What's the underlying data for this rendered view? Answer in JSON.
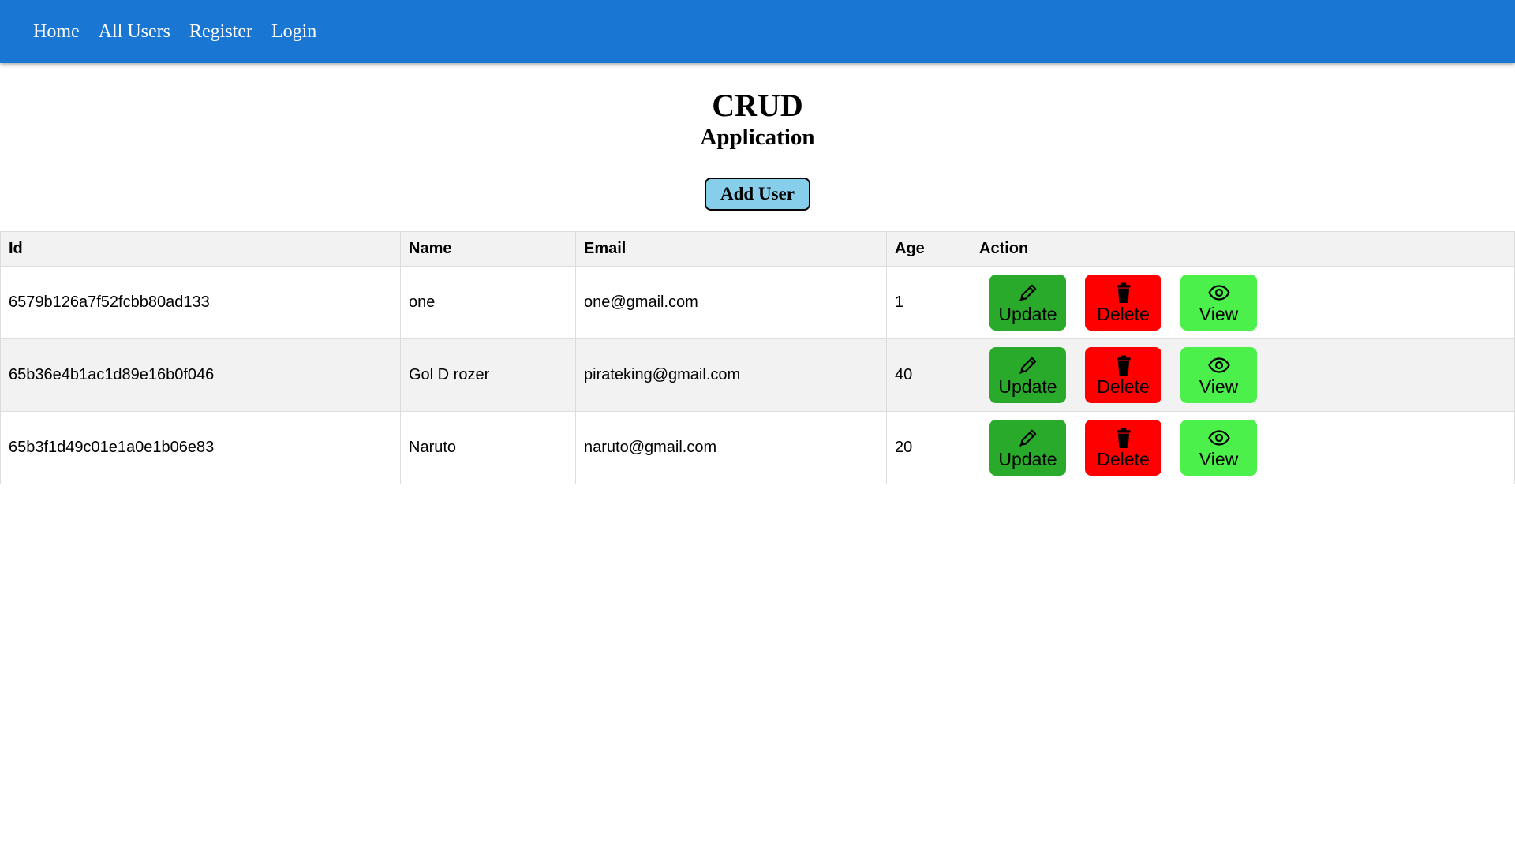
{
  "nav": {
    "links": [
      "Home",
      "All Users",
      "Register",
      "Login"
    ]
  },
  "header": {
    "title": "CRUD",
    "subtitle": "Application",
    "add_button": "Add User"
  },
  "table": {
    "columns": [
      "Id",
      "Name",
      "Email",
      "Age",
      "Action"
    ],
    "rows": [
      {
        "id": "6579b126a7f52fcbb80ad133",
        "name": "one",
        "email": "one@gmail.com",
        "age": "1"
      },
      {
        "id": "65b36e4b1ac1d89e16b0f046",
        "name": "Gol D rozer",
        "email": "pirateking@gmail.com",
        "age": "40"
      },
      {
        "id": "65b3f1d49c01e1a0e1b06e83",
        "name": "Naruto",
        "email": "naruto@gmail.com",
        "age": "20"
      }
    ],
    "actions": {
      "update": {
        "label": "Update",
        "icon": "pen-icon",
        "color": "#2aaa2a"
      },
      "delete": {
        "label": "Delete",
        "icon": "trash-icon",
        "color": "#ff0000"
      },
      "view": {
        "label": "View",
        "icon": "eye-icon",
        "color": "#4bf04b"
      }
    }
  },
  "colors": {
    "navbar": "#1976d2",
    "add_button": "#87ceeb",
    "row_alt": "#f2f2f2"
  }
}
